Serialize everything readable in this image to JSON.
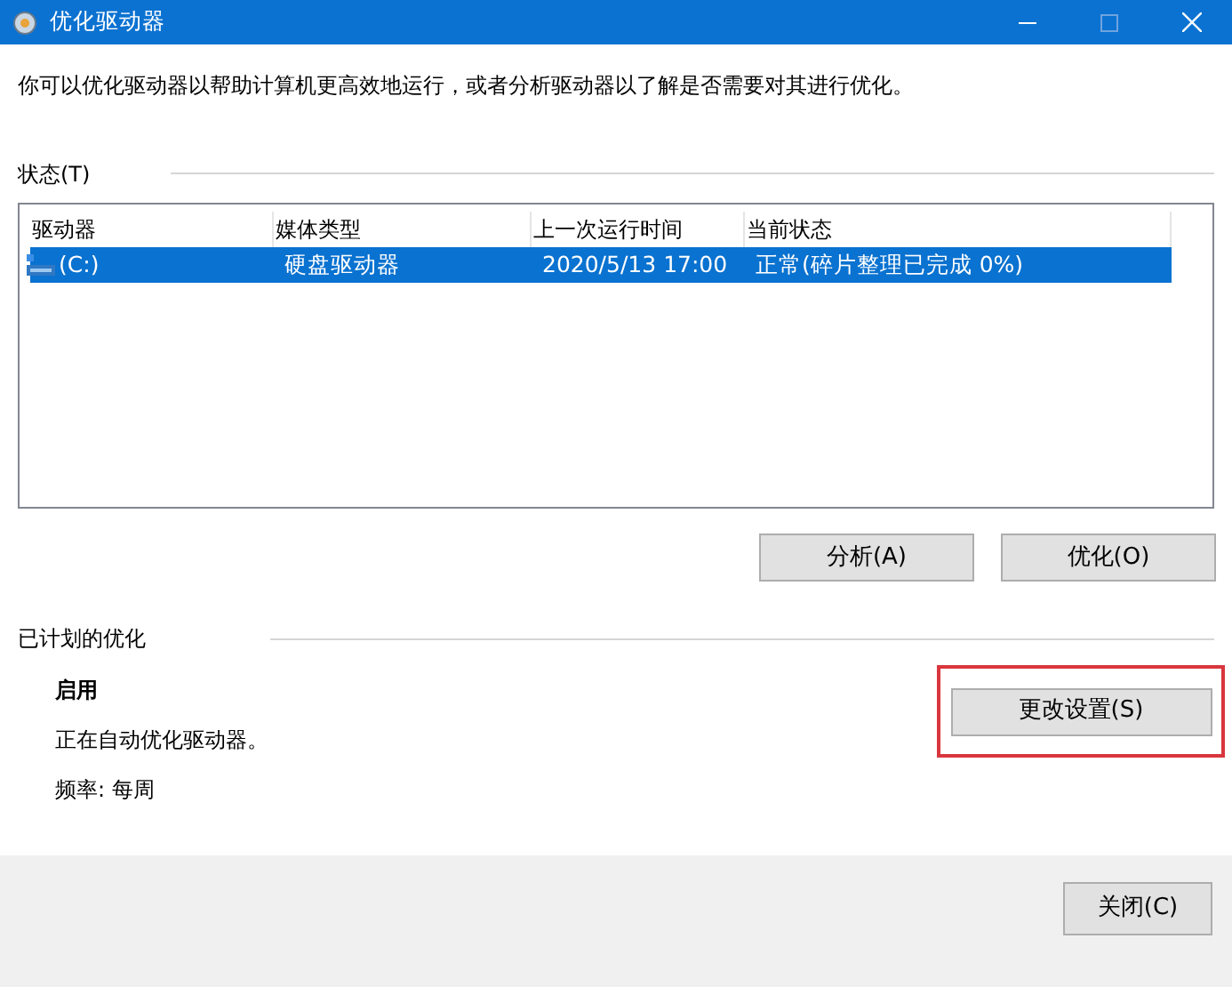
{
  "window": {
    "title": "优化驱动器"
  },
  "description": "你可以优化驱动器以帮助计算机更高效地运行，或者分析驱动器以了解是否需要对其进行优化。",
  "status_section": {
    "label": "状态(T)"
  },
  "table": {
    "columns": [
      "驱动器",
      "媒体类型",
      "上一次运行时间",
      "当前状态"
    ],
    "rows": [
      {
        "selected": true,
        "cells": [
          "(C:)",
          "硬盘驱动器",
          "2020/5/13 17:00",
          "正常(碎片整理已完成 0%)"
        ]
      }
    ]
  },
  "actions": [
    {
      "label": "分析(A)"
    },
    {
      "label": "优化(O)"
    }
  ],
  "schedule": {
    "label": "已计划的优化",
    "state": "启用",
    "detail": "正在自动优化驱动器。",
    "frequency": "频率: 每周",
    "button": {
      "label": "更改设置(S)",
      "highlighted": true
    }
  },
  "footer": {
    "close_button": "关闭(C)"
  }
}
